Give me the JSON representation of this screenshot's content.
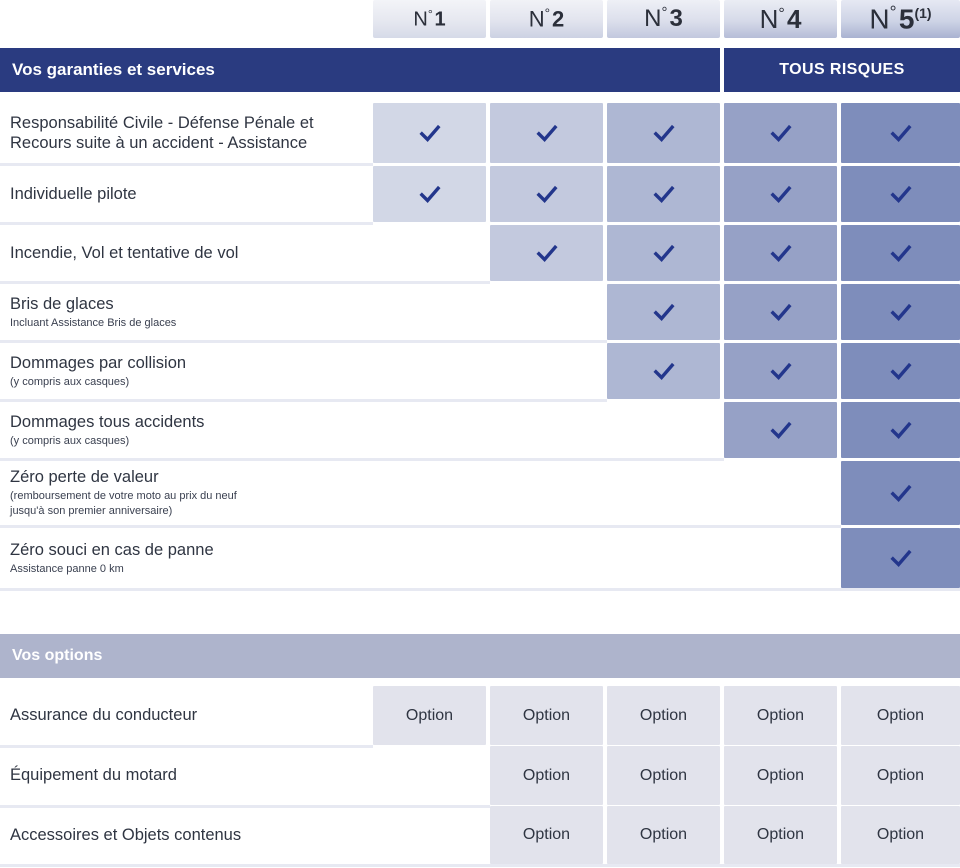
{
  "columns": [
    {
      "id": "col1",
      "label": "N° 1",
      "prefix": "N",
      "degree": "°",
      "number": "1",
      "note": ""
    },
    {
      "id": "col2",
      "label": "N° 2",
      "prefix": "N",
      "degree": "°",
      "number": "2",
      "note": ""
    },
    {
      "id": "col3",
      "label": "N° 3",
      "prefix": "N",
      "degree": "°",
      "number": "3",
      "note": ""
    },
    {
      "id": "col4",
      "label": "N° 4",
      "prefix": "N",
      "degree": "°",
      "number": "4",
      "note": ""
    },
    {
      "id": "col5",
      "label": "N° 5",
      "prefix": "N",
      "degree": "°",
      "number": "5",
      "note": "(1)"
    }
  ],
  "sections": {
    "guarantees": {
      "title": "Vos garanties et services",
      "banner": "TOUS RISQUES",
      "banner_columns": [
        "col4",
        "col5"
      ],
      "rows": [
        {
          "title": "Responsabilité Civile - Défense Pénale et",
          "title_line2": "Recours suite à un accident - Assistance",
          "subtitle": "",
          "marks": [
            "check",
            "check",
            "check",
            "check",
            "check"
          ]
        },
        {
          "title": "Individuelle pilote",
          "title_line2": "",
          "subtitle": "",
          "marks": [
            "check",
            "check",
            "check",
            "check",
            "check"
          ]
        },
        {
          "title": "Incendie, Vol et tentative de vol",
          "title_line2": "",
          "subtitle": "",
          "marks": [
            "",
            "check",
            "check",
            "check",
            "check"
          ]
        },
        {
          "title": "Bris de glaces",
          "title_line2": "",
          "subtitle": "Incluant Assistance Bris de glaces",
          "marks": [
            "",
            "",
            "check",
            "check",
            "check"
          ]
        },
        {
          "title": "Dommages par collision",
          "title_line2": "",
          "subtitle": "(y compris aux casques)",
          "marks": [
            "",
            "",
            "check",
            "check",
            "check"
          ]
        },
        {
          "title": "Dommages tous accidents",
          "title_line2": "",
          "subtitle": "(y compris aux casques)",
          "marks": [
            "",
            "",
            "",
            "check",
            "check"
          ]
        },
        {
          "title": "Zéro perte de valeur",
          "title_line2": "",
          "subtitle": "(remboursement de votre moto au prix du neuf",
          "subtitle_line2": "jusqu'à son premier anniversaire)",
          "marks": [
            "",
            "",
            "",
            "",
            "check"
          ]
        },
        {
          "title": "Zéro souci en cas de panne",
          "title_line2": "",
          "subtitle": "Assistance panne 0 km",
          "marks": [
            "",
            "",
            "",
            "",
            "check"
          ]
        }
      ]
    },
    "options": {
      "title": "Vos options",
      "option_label": "Option",
      "rows": [
        {
          "title": "Assurance du conducteur",
          "marks": [
            "Option",
            "Option",
            "Option",
            "Option",
            "Option"
          ]
        },
        {
          "title": "Équipement du motard",
          "marks": [
            "",
            "Option",
            "Option",
            "Option",
            "Option"
          ]
        },
        {
          "title": "Accessoires et Objets contenus",
          "marks": [
            "",
            "Option",
            "Option",
            "Option",
            "Option"
          ]
        }
      ]
    }
  },
  "colors": {
    "navy": "#2a3b80",
    "check": "#23368c",
    "options_header": "#aeb4cc",
    "col1": "#d2d7e6",
    "col2": "#c3c9de",
    "col3": "#aeb7d3",
    "col4": "#96a1c6",
    "col5": "#7e8dbb",
    "option_cell": "#e2e3ec",
    "rule": "#e7e9f2"
  }
}
